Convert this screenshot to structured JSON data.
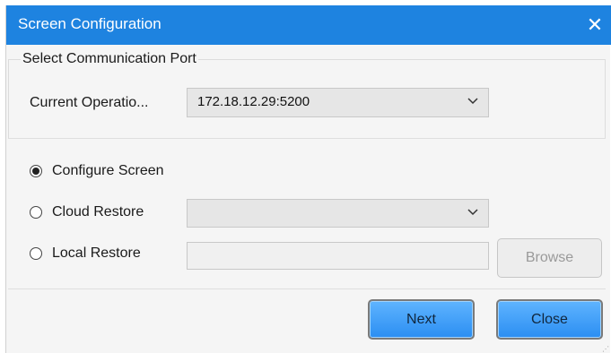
{
  "window": {
    "title": "Screen Configuration",
    "close_icon": "close-icon",
    "colors": {
      "titlebar": "#1e83e0",
      "button_primary": "#2b8ef2"
    }
  },
  "comm_port": {
    "group_title": "Select Communication Port",
    "current_operation_label": "Current Operatio...",
    "current_operation_value": "172.18.12.29:5200"
  },
  "options": {
    "configure_screen": {
      "label": "Configure Screen",
      "selected": true
    },
    "cloud_restore": {
      "label": "Cloud Restore",
      "selected": false,
      "dropdown_value": ""
    },
    "local_restore": {
      "label": "Local Restore",
      "selected": false,
      "path_value": "",
      "browse_label": "Browse"
    }
  },
  "footer": {
    "next_label": "Next",
    "close_label": "Close"
  }
}
